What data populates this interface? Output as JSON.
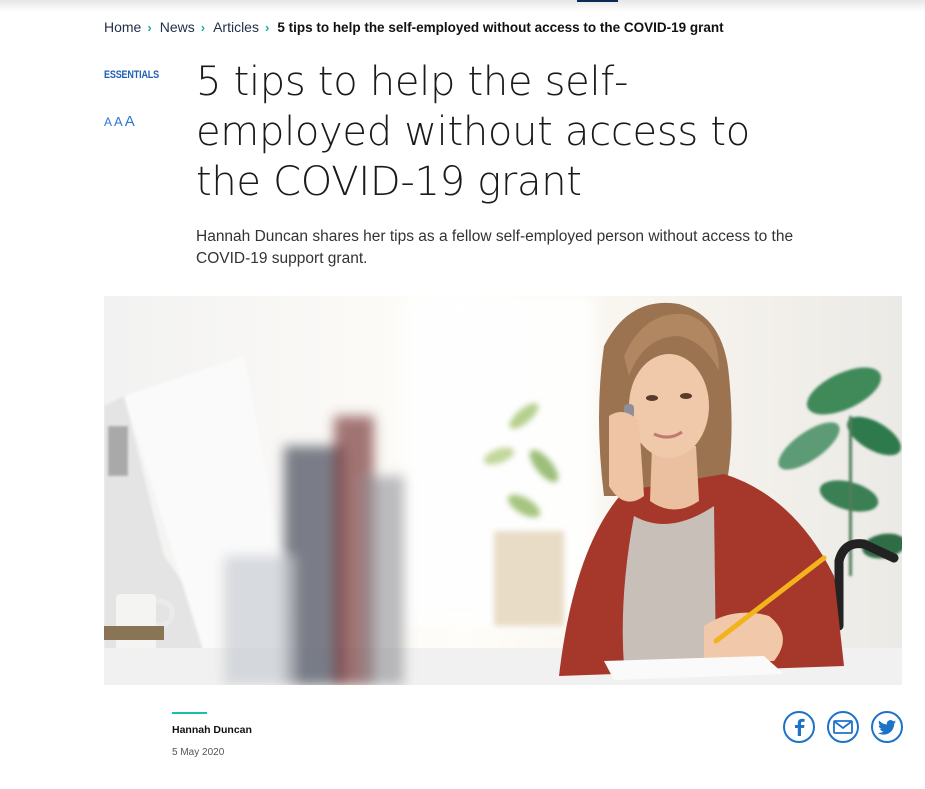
{
  "breadcrumb": {
    "items": [
      {
        "label": "Home"
      },
      {
        "label": "News"
      },
      {
        "label": "Articles"
      }
    ],
    "current": "5 tips to help the self-employed without access to the COVID-19 grant"
  },
  "article": {
    "tag": "ESSENTIALS",
    "text_size_controls": [
      "A",
      "A",
      "A"
    ],
    "title": "5 tips to help the self-employed without access to the COVID-19 grant",
    "subtitle": "Hannah Duncan shares her tips as a fellow self-employed person without access to the COVID-19 support grant.",
    "hero_image_alt": "Woman on the phone writing notes at a desk",
    "author": "Hannah Duncan",
    "date": "5 May 2020"
  },
  "share": {
    "icons": [
      "facebook-icon",
      "email-icon",
      "twitter-icon"
    ]
  },
  "colors": {
    "link": "#23304a",
    "accent_teal": "#19b3a3",
    "brand_blue": "#1e72c8",
    "tag_blue": "#1f5fb8"
  }
}
